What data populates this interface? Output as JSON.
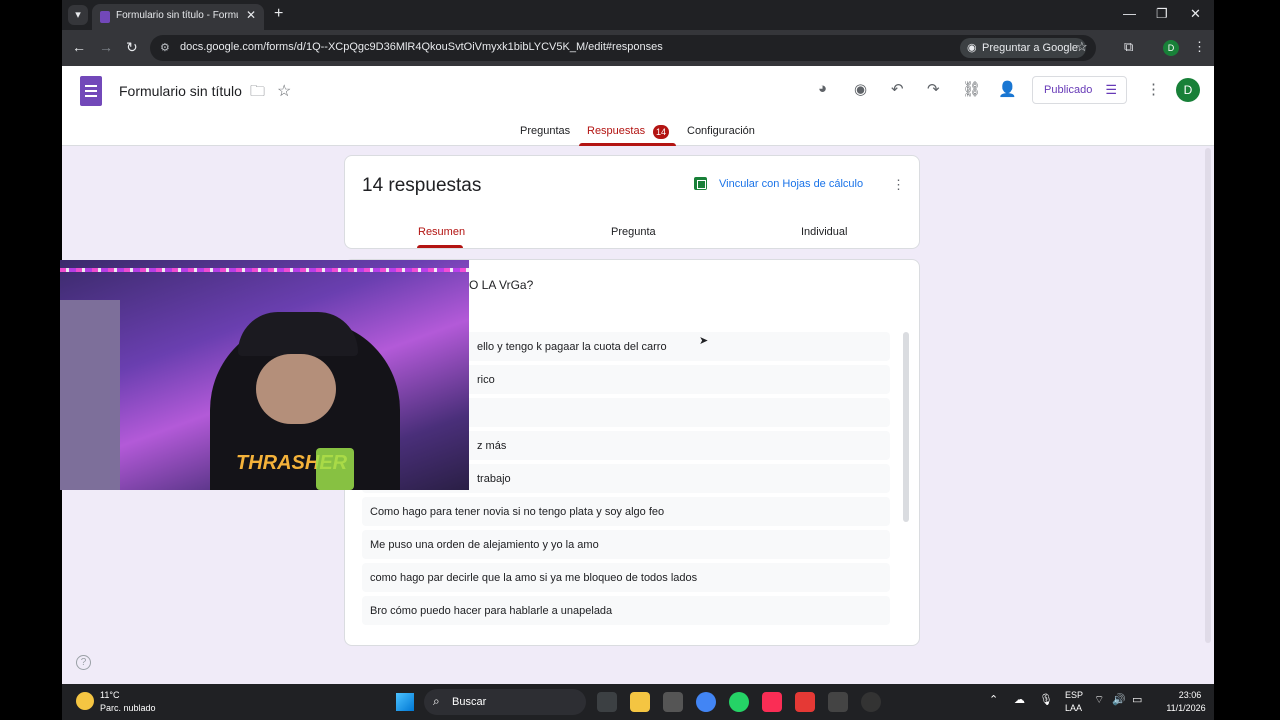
{
  "browser": {
    "tab_title": "Formulario sin título - Formulari",
    "url": "docs.google.com/forms/d/1Q--XCpQgc9D36MlR4QkouSvtOiVmyxk1bibLYCV5K_M/edit#responses",
    "ask_google": "Preguntar a Google",
    "profile_initial": "D"
  },
  "form_header": {
    "title": "Formulario sin título",
    "publish_label": "Publicado",
    "avatar_initial": "D",
    "tabs": [
      {
        "label": "Preguntas"
      },
      {
        "label": "Respuestas",
        "badge": "14"
      },
      {
        "label": "Configuración"
      }
    ]
  },
  "summary": {
    "count_label": "14 respuestas",
    "link_sheets": "Vincular con Hojas de cálculo",
    "sub_tabs": [
      "Resumen",
      "Pregunta",
      "Individual"
    ]
  },
  "question": {
    "title_visible": "O LA VrGa?",
    "answers": [
      "ello y tengo k pagaar la cuota del carro",
      "rico",
      "",
      "z más",
      "trabajo",
      "Como hago para tener novia si no tengo plata y soy algo feo",
      "Me puso una orden de alejamiento y yo la amo",
      "como hago par decirle que la amo si ya me bloqueo de todos lados",
      "Bro cómo puedo hacer para hablarle a unapelada"
    ]
  },
  "webcam": {
    "shirt_text": "THRASHER"
  },
  "taskbar": {
    "temperature": "11°C",
    "condition": "Parc. nublado",
    "search_label": "Buscar",
    "lang_line1": "ESP",
    "lang_line2": "LAA",
    "time": "23:06",
    "date": "11/1/2026"
  },
  "colors": {
    "accent_red": "#b31412",
    "forms_purple": "#7248b9",
    "page_bg": "#f0ebf8"
  }
}
